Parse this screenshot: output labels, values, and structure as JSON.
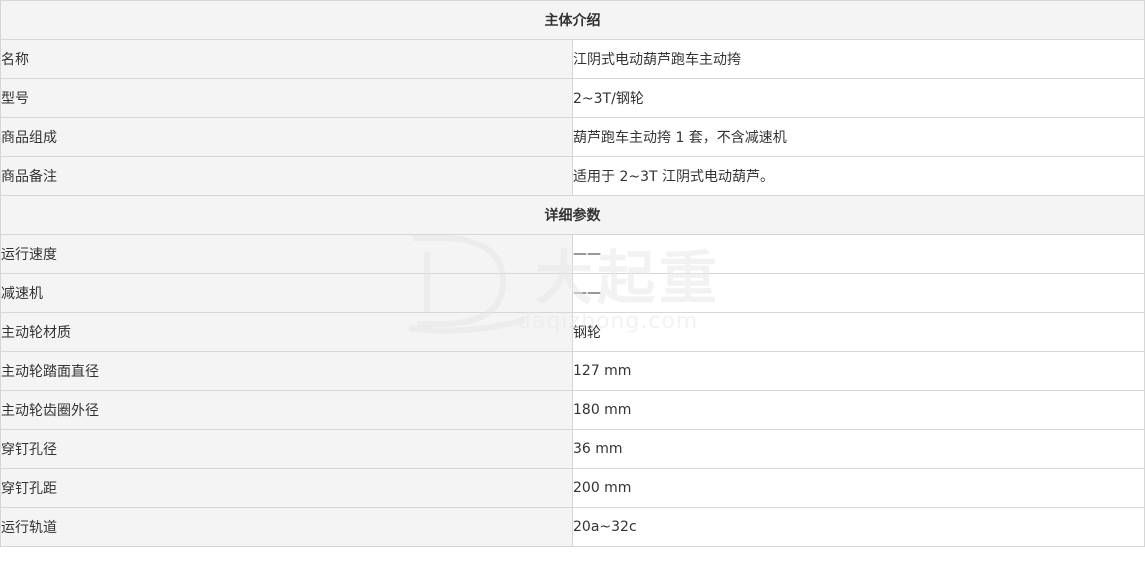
{
  "section_intro": {
    "title": "主体介绍",
    "rows": [
      {
        "label": "名称",
        "value": "江阴式电动葫芦跑车主动挎"
      },
      {
        "label": "型号",
        "value": "2~3T/钢轮"
      },
      {
        "label": "商品组成",
        "value": "葫芦跑车主动挎 1 套，不含减速机"
      },
      {
        "label": "商品备注",
        "value": "适用于 2~3T 江阴式电动葫芦。"
      }
    ]
  },
  "section_params": {
    "title": "详细参数",
    "rows": [
      {
        "label": "运行速度",
        "value": "——"
      },
      {
        "label": "减速机",
        "value": "——"
      },
      {
        "label": "主动轮材质",
        "value": "钢轮"
      },
      {
        "label": "主动轮踏面直径",
        "value": "127 mm"
      },
      {
        "label": "主动轮齿圈外径",
        "value": "180 mm"
      },
      {
        "label": "穿钉孔径",
        "value": "36 mm"
      },
      {
        "label": "穿钉孔距",
        "value": "200 mm"
      },
      {
        "label": "运行轨道",
        "value": "20a~32c"
      }
    ]
  },
  "watermark": {
    "logo_text": "大起重",
    "url_text": "daqizhong.com",
    "color": "#e9e9e9"
  }
}
